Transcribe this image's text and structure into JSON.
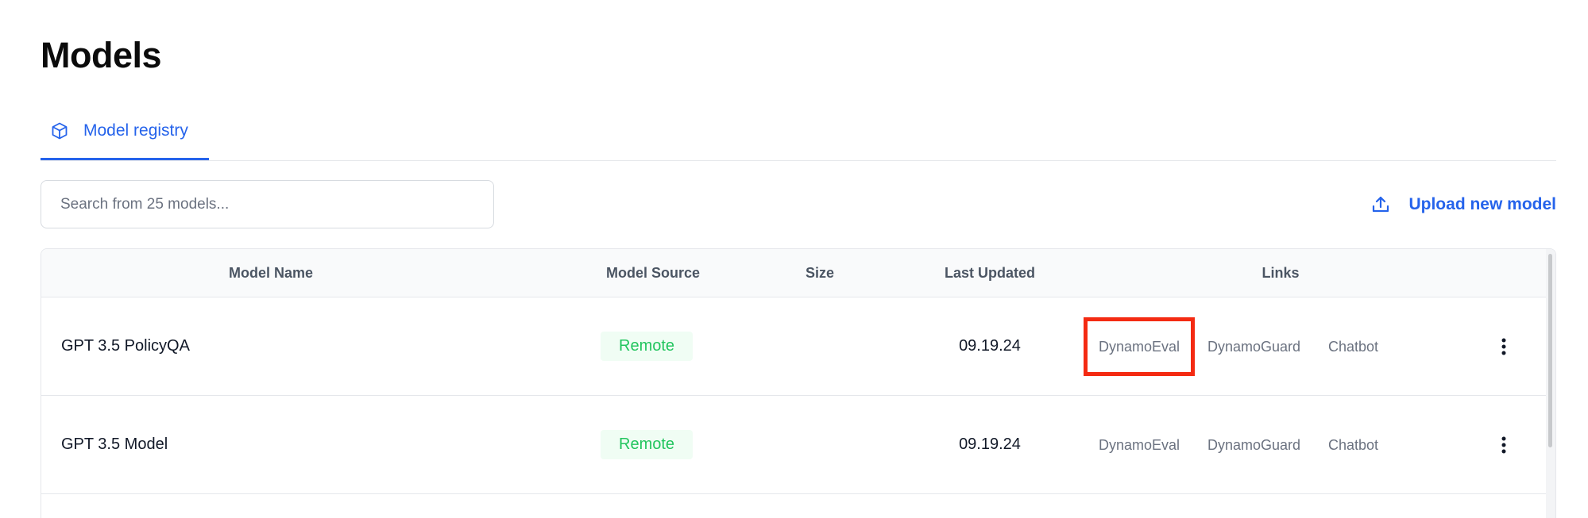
{
  "page": {
    "title": "Models"
  },
  "tabs": [
    {
      "label": "Model registry",
      "icon": "cube-icon",
      "active": true
    }
  ],
  "search": {
    "placeholder": "Search from 25 models...",
    "value": ""
  },
  "upload": {
    "label": "Upload new model",
    "icon": "upload-icon"
  },
  "table": {
    "columns": [
      "Model Name",
      "Model Source",
      "Size",
      "Last Updated",
      "Links"
    ],
    "rows": [
      {
        "name": "GPT 3.5 PolicyQA",
        "source": "Remote",
        "size": "",
        "updated": "09.19.24",
        "links": [
          "DynamoEval",
          "DynamoGuard",
          "Chatbot"
        ]
      },
      {
        "name": "GPT 3.5 Model",
        "source": "Remote",
        "size": "",
        "updated": "09.19.24",
        "links": [
          "DynamoEval",
          "DynamoGuard",
          "Chatbot"
        ]
      }
    ]
  },
  "colors": {
    "accent": "#2563eb",
    "badge_text": "#22c55e",
    "badge_bg": "#f0fdf4",
    "highlight": "#f42a12"
  }
}
